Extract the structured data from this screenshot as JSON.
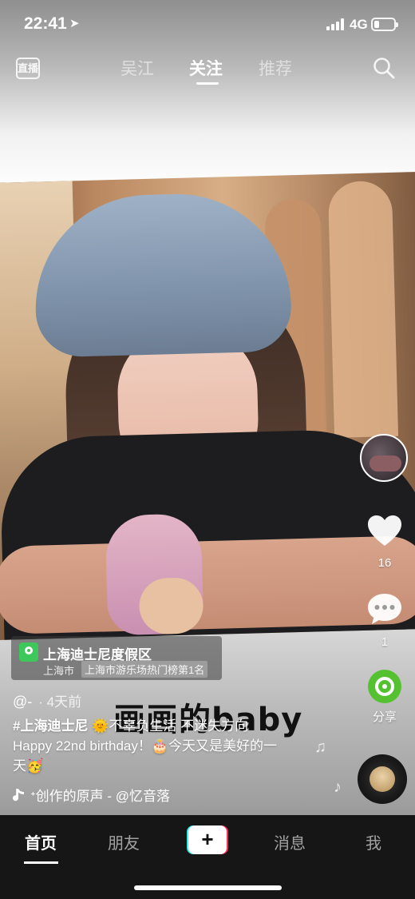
{
  "status_bar": {
    "time": "22:41",
    "location_arrow": "➤",
    "network": "4G",
    "battery_level": 0.25
  },
  "top_nav": {
    "live_label": "直播",
    "tabs": [
      {
        "label": "吴江",
        "active": false
      },
      {
        "label": "关注",
        "active": true
      },
      {
        "label": "推荐",
        "active": false
      }
    ]
  },
  "actions": {
    "like_count": "16",
    "comment_count": "1",
    "share_label": "分享"
  },
  "location": {
    "name": "上海迪士尼度假区",
    "city": "上海市",
    "rank": "上海市游乐场热门榜第1名"
  },
  "post": {
    "author": "@-",
    "time_ago": "· 4天前",
    "overlay_title": "画画的baby",
    "hashtag": "#上海迪士尼",
    "caption_line1": "🌞不辜负生活 不迷失方向",
    "caption_line2": "Happy 22nd birthday！🎂今天又是美好的一",
    "caption_line3": "天🥳",
    "music_text": "ᐩ创作的原声 - @忆音落"
  },
  "tab_bar": {
    "tabs": [
      {
        "label": "首页",
        "active": true
      },
      {
        "label": "朋友",
        "active": false
      },
      {
        "label": "消息",
        "active": false
      },
      {
        "label": "我",
        "active": false
      }
    ],
    "plus_label": "+"
  },
  "colors": {
    "share_green": "#56c130",
    "location_pin": "#3cc85a",
    "tab_bar_bg": "#161616",
    "plus_cyan": "#25f4ee",
    "plus_red": "#fe2c55"
  },
  "icons": [
    "location-arrow-icon",
    "signal-icon",
    "battery-icon",
    "live-icon",
    "search-icon",
    "heart-icon",
    "comment-icon",
    "share-icon",
    "location-pin-icon",
    "music-note-icon",
    "music-disc-icon",
    "plus-icon"
  ]
}
